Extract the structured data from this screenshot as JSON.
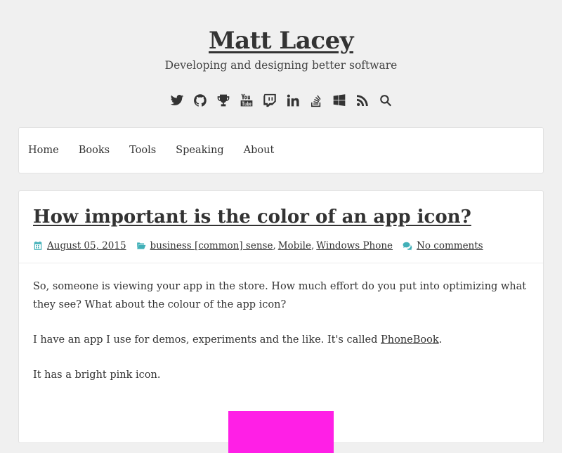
{
  "header": {
    "title": "Matt Lacey",
    "tagline": "Developing and designing better software"
  },
  "social_icons": [
    "twitter-icon",
    "github-icon",
    "trophy-icon",
    "youtube-icon",
    "twitch-icon",
    "linkedin-icon",
    "stackoverflow-icon",
    "windows-icon",
    "rss-icon",
    "search-icon"
  ],
  "nav": {
    "items": [
      {
        "label": "Home"
      },
      {
        "label": "Books"
      },
      {
        "label": "Tools"
      },
      {
        "label": "Speaking"
      },
      {
        "label": "About"
      }
    ]
  },
  "post": {
    "title": "How important is the color of an app icon?",
    "date": "August 05, 2015",
    "categories": [
      "business [common] sense",
      "Mobile",
      "Windows Phone"
    ],
    "comments": "No comments",
    "paragraph1": "So, someone is viewing your app in the store. How much effort do you put into optimizing what they see? What about the colour of the app icon?",
    "paragraph2_before": "I have an app I use for demos, experiments and the like. It's called ",
    "paragraph2_link": "PhoneBook",
    "paragraph2_after": ".",
    "paragraph3": "It has a bright pink icon."
  },
  "colors": {
    "background": "#f0f0f0",
    "meta_icon": "#41b0b8",
    "app_icon": "#ff1fe6"
  }
}
